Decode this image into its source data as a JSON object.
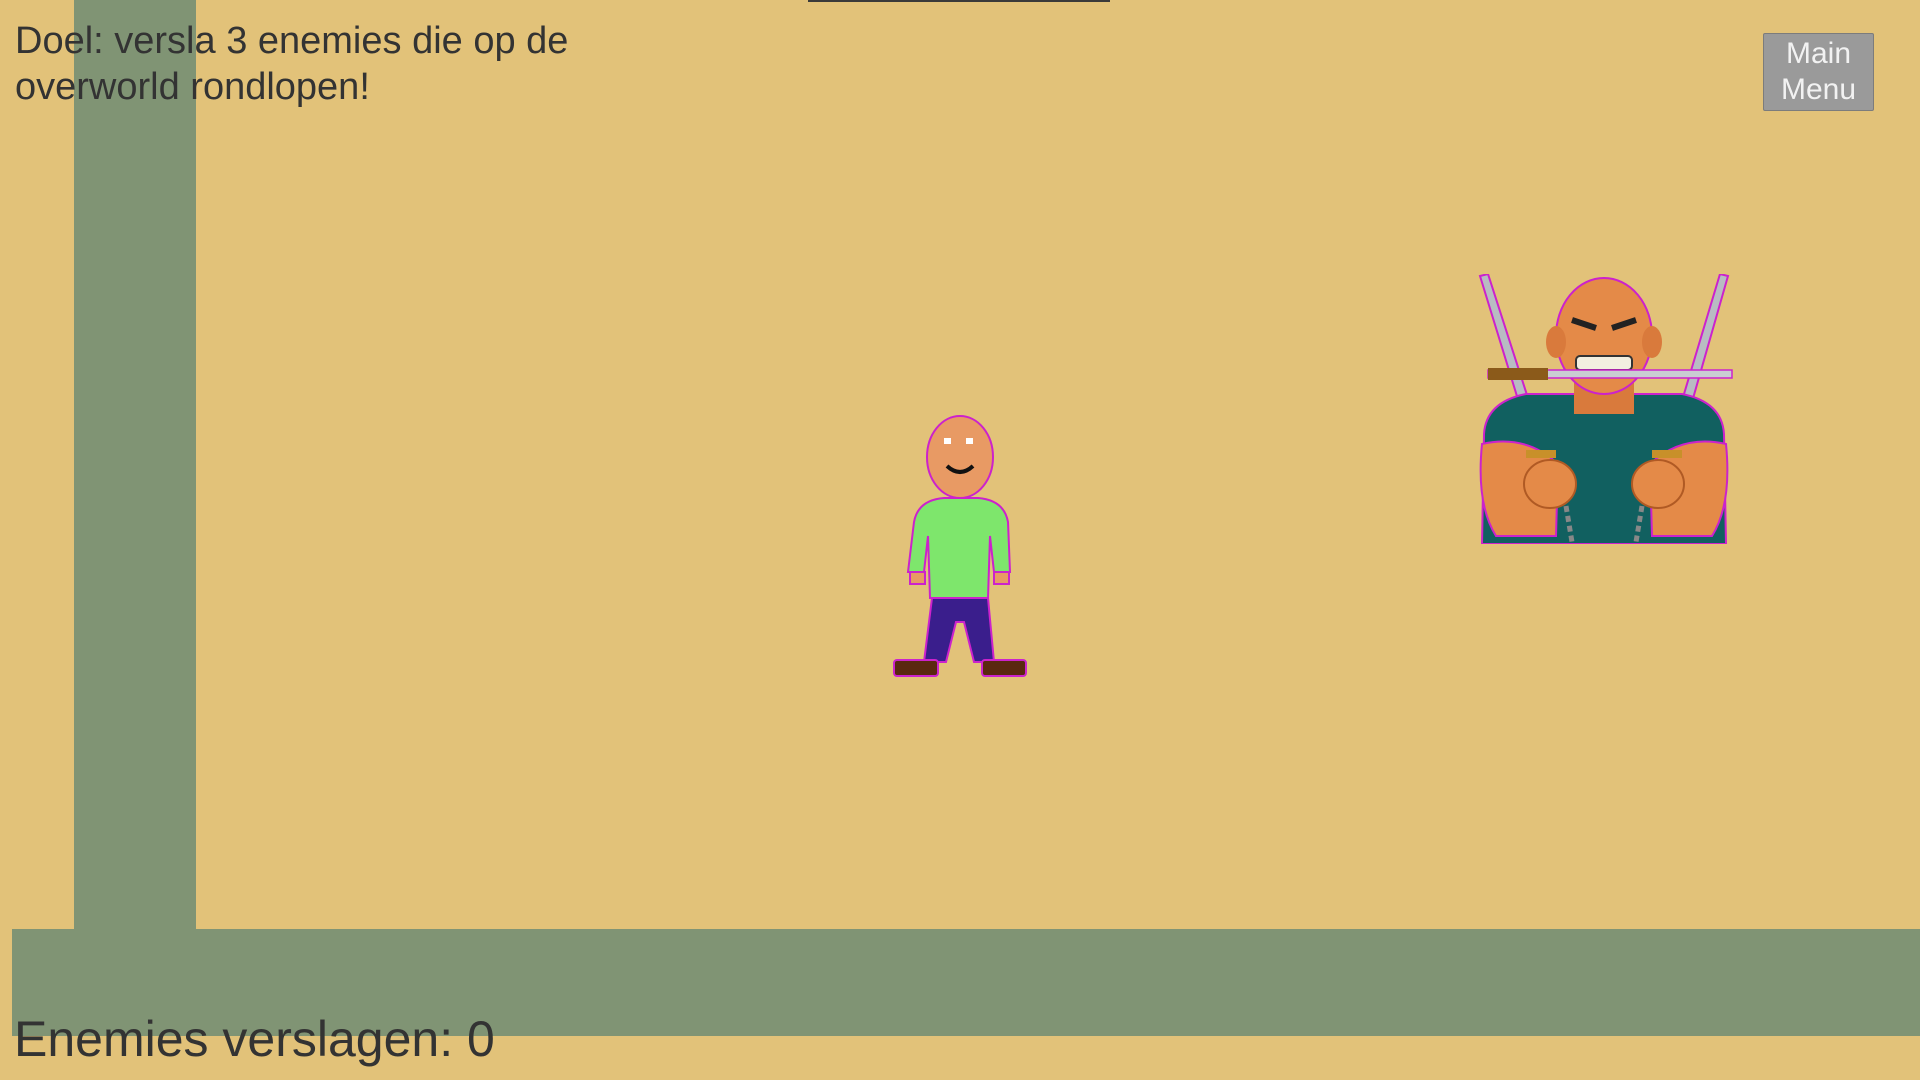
{
  "hud": {
    "objective": "Doel: versla 3 enemies die op de overworld rondlopen!",
    "main_menu_label": "Main Menu",
    "enemies_defeated": "Enemies verslagen: 0"
  },
  "world": {
    "ground_color": "#e2c279",
    "wall_color": "#809474"
  },
  "sprites": {
    "player": "player-character",
    "enemy": "bald-brute-with-katanas"
  }
}
